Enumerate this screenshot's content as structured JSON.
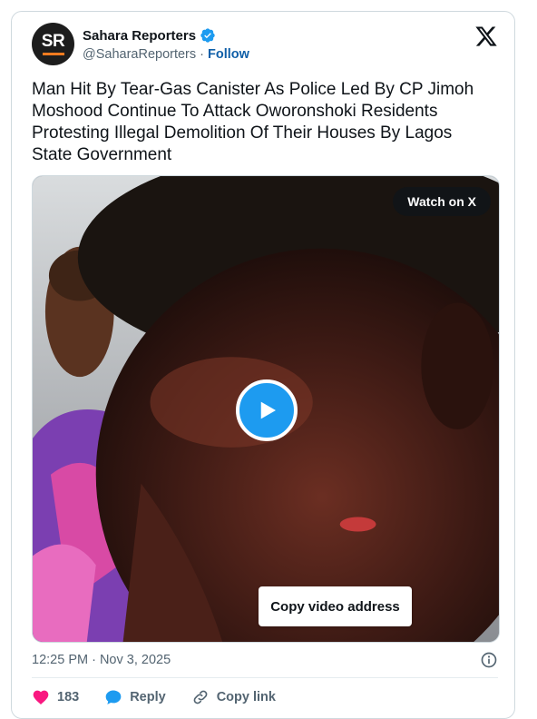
{
  "author": {
    "name": "Sahara Reporters",
    "handle": "@SaharaReporters",
    "separator": "·",
    "follow_label": "Follow",
    "avatar_initials": "SR",
    "avatar_bg": "#1d1d1d",
    "avatar_accent": "#f47b20",
    "verified_icon": "verified-badge-icon"
  },
  "platform_icon": "x-logo-icon",
  "tweet_text": "Man Hit By Tear-Gas Canister As Police Led By CP Jimoh Moshood Continue To Attack Oworonshoki Residents Protesting Illegal Demolition Of Their Houses By Lagos State Government",
  "media": {
    "watch_label": "Watch on X",
    "copy_label": "Copy video address",
    "play_icon": "play-icon"
  },
  "meta": {
    "timestamp": "12:25 PM · Nov 3, 2025",
    "info_icon": "info-icon"
  },
  "actions": {
    "likes": "183",
    "reply_label": "Reply",
    "copy_link_label": "Copy link"
  },
  "colors": {
    "accent": "#1d9bf0",
    "follow": "#0f5fa8",
    "like": "#f91880",
    "muted": "#536471"
  }
}
